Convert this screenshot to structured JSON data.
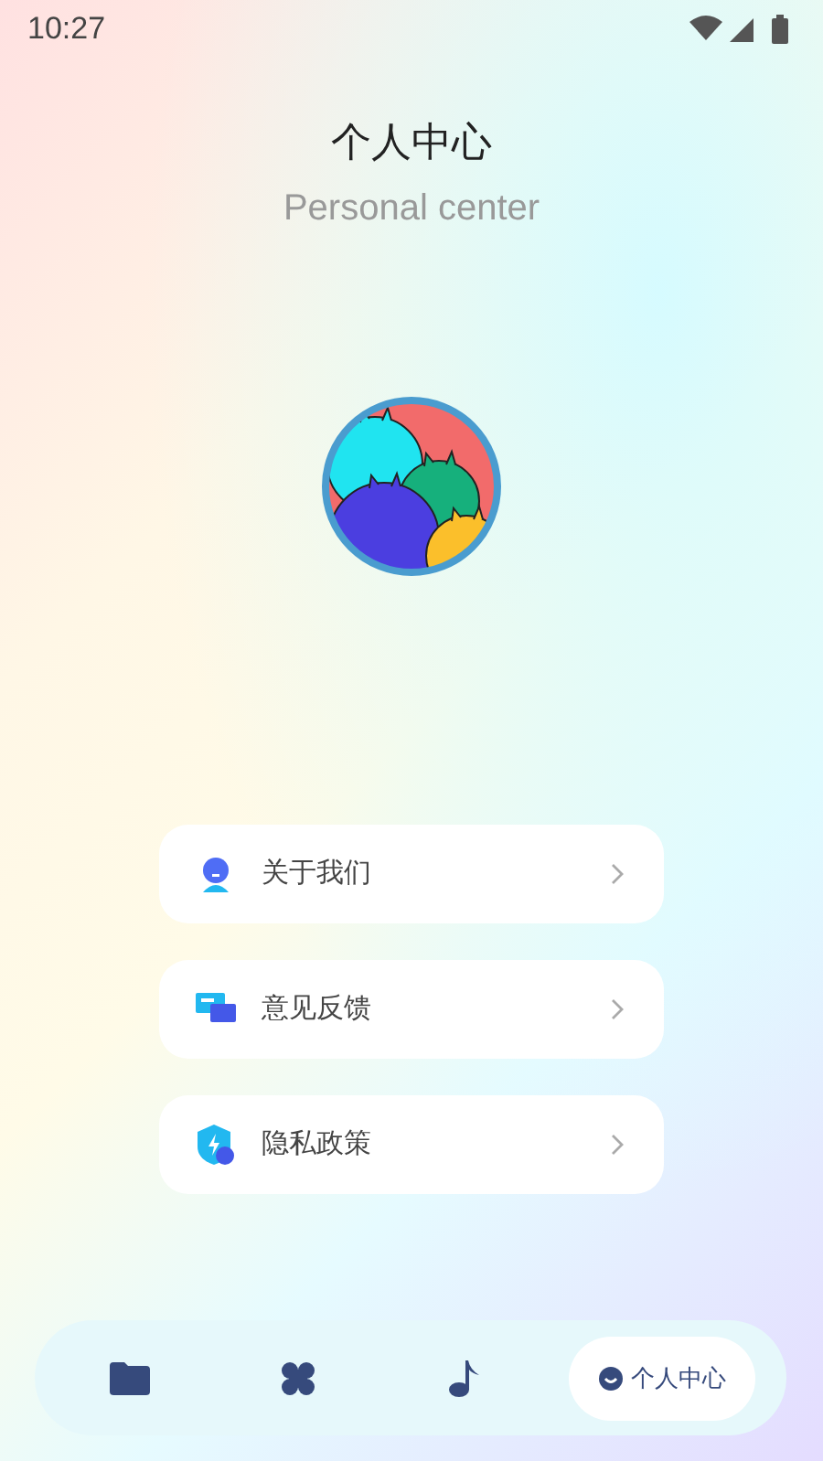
{
  "status_bar": {
    "time": "10:27"
  },
  "header": {
    "title": "个人中心",
    "subtitle": "Personal center"
  },
  "menu": [
    {
      "kind": "about",
      "label": "关于我们"
    },
    {
      "kind": "feedback",
      "label": "意见反馈"
    },
    {
      "kind": "privacy",
      "label": "隐私政策"
    }
  ],
  "nav": [
    {
      "kind": "folder",
      "selected": false
    },
    {
      "kind": "clover",
      "selected": false
    },
    {
      "kind": "music",
      "selected": false
    },
    {
      "kind": "profile",
      "selected": true,
      "label": "个人中心"
    }
  ]
}
